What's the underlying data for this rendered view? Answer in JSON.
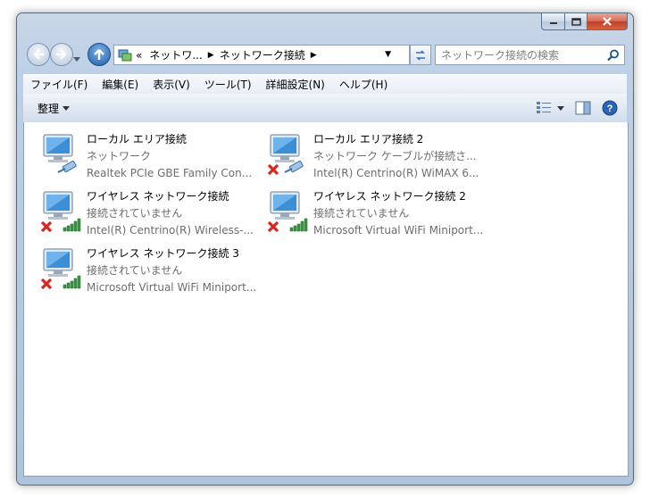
{
  "window": {
    "caption": {
      "minimize_glyph": "─",
      "maximize_glyph": "□",
      "close_glyph": "✕"
    }
  },
  "navigation": {
    "address_prefix": "«",
    "breadcrumb": [
      "ネットワ...",
      "ネットワーク接続"
    ],
    "search_placeholder": "ネットワーク接続の検索"
  },
  "menubar": {
    "items": [
      "ファイル(F)",
      "編集(E)",
      "表示(V)",
      "ツール(T)",
      "詳細設定(N)",
      "ヘルプ(H)"
    ]
  },
  "commandbar": {
    "organize_label": "整理"
  },
  "connections": [
    {
      "name": "ローカル エリア接続",
      "status": "ネットワーク",
      "device": "Realtek PCIe GBE Family Con...",
      "type": "wired",
      "disconnected": false
    },
    {
      "name": "ローカル エリア接続 2",
      "status": "ネットワーク ケーブルが接続さ...",
      "device": "Intel(R) Centrino(R) WiMAX 6...",
      "type": "wired",
      "disconnected": true
    },
    {
      "name": "ワイヤレス ネットワーク接続",
      "status": "接続されていません",
      "device": "Intel(R) Centrino(R) Wireless-...",
      "type": "wireless",
      "disconnected": true
    },
    {
      "name": "ワイヤレス ネットワーク接続 2",
      "status": "接続されていません",
      "device": "Microsoft Virtual WiFi Miniport...",
      "type": "wireless",
      "disconnected": true
    },
    {
      "name": "ワイヤレス ネットワーク接続 3",
      "status": "接続されていません",
      "device": "Microsoft Virtual WiFi Miniport...",
      "type": "wireless",
      "disconnected": true
    }
  ],
  "colors": {
    "chrome": "#bcd0e6",
    "disconnect_x": "#d9251d",
    "signal": "#2f9e3a",
    "monitor": "#3a8fd6"
  }
}
